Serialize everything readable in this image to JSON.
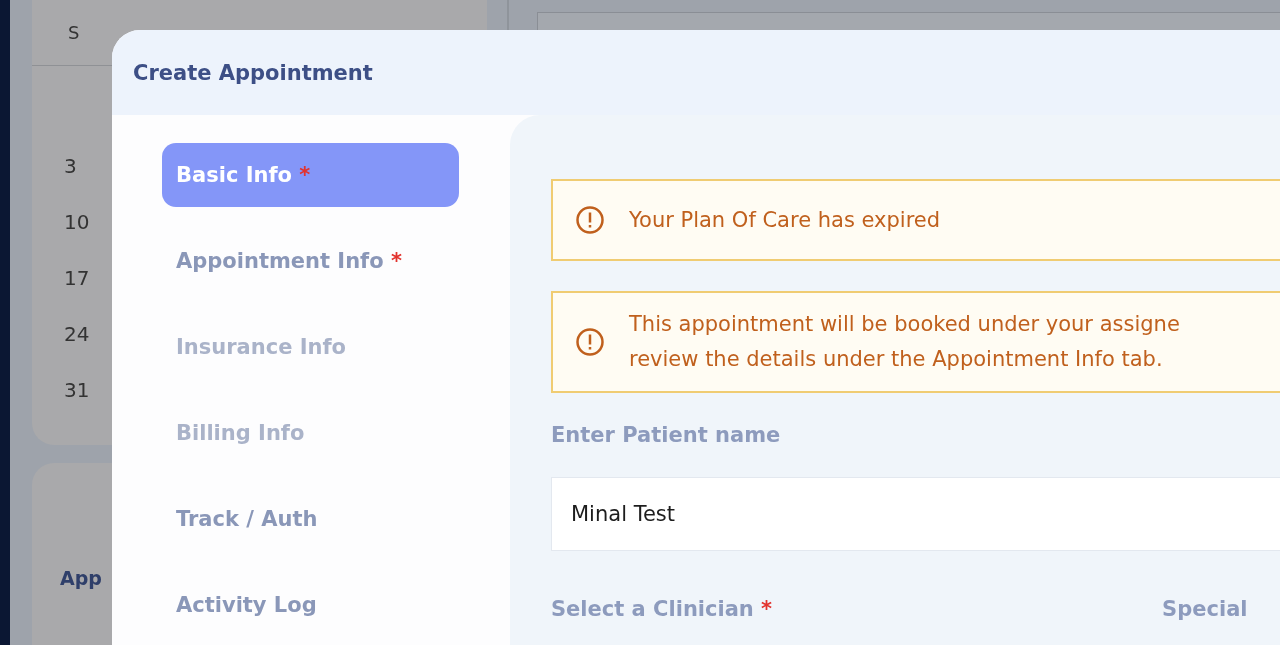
{
  "background": {
    "weekday": "S",
    "dates": [
      "3",
      "10",
      "17",
      "24",
      "31"
    ],
    "card_label": "App"
  },
  "modal": {
    "title": "Create Appointment",
    "tabs": [
      {
        "label": "Basic Info",
        "mark": "*",
        "selected": true,
        "disabled": false
      },
      {
        "label": "Appointment Info",
        "mark": "*",
        "selected": false,
        "disabled": false
      },
      {
        "label": "Insurance Info",
        "selected": false,
        "disabled": true
      },
      {
        "label": "Billing Info",
        "selected": false,
        "disabled": true
      },
      {
        "label": "Track / Auth",
        "selected": false,
        "disabled": false
      },
      {
        "label": "Activity Log",
        "selected": false,
        "disabled": false
      }
    ],
    "alerts": [
      {
        "lines": [
          "Your Plan Of Care has expired"
        ]
      },
      {
        "lines": [
          "This appointment will be booked under your assigne",
          "review the details under the Appointment Info tab."
        ]
      }
    ],
    "patient_field": {
      "label": "Enter Patient name",
      "value": "Minal Test"
    },
    "clinician_label": {
      "label": "Select a Clinician",
      "mark": "*"
    },
    "specialty_label": {
      "label": "Special"
    }
  }
}
